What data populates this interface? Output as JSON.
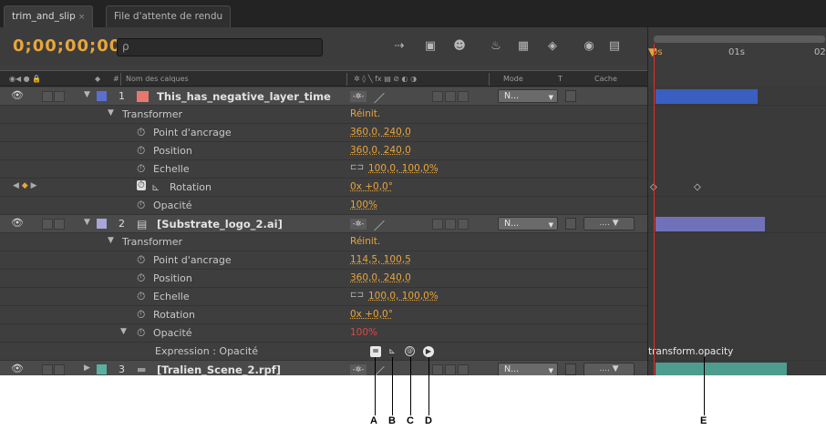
{
  "tabs": [
    {
      "label": "trim_and_slip",
      "close": "×"
    },
    {
      "label": "File d'attente de rendu"
    }
  ],
  "toolbar": {
    "timecode": "0;00;00;00",
    "search_icon": "ρ"
  },
  "columns": {
    "layer_name": "Nom des calques",
    "mode": "Mode",
    "t": "T",
    "cache": "Cache"
  },
  "timeline": {
    "ticks": [
      "0s",
      "01s",
      "02"
    ],
    "expression_text": "transform.opacity"
  },
  "layers": [
    {
      "index": "1",
      "name": "This_has_negative_layer_time",
      "color": "#e6786d",
      "mode": "N..."
    },
    {
      "index": "2",
      "name": "[Substrate_logo_2.ai]",
      "mode": "N..."
    },
    {
      "index": "3",
      "name": "[Tralien_Scene_2.rpf]",
      "mode": "N..."
    }
  ],
  "props1": {
    "transformer": "Transformer",
    "reinit": "Réinit.",
    "anchor": "Point d'ancrage",
    "anchor_val": "360,0, 240,0",
    "position": "Position",
    "position_val": "360,0, 240,0",
    "scale": "Echelle",
    "scale_val": "100,0, 100,0%",
    "rotation": "Rotation",
    "rotation_val": "0x +0,0°",
    "opacity": "Opacité",
    "opacity_val": "100%"
  },
  "props2": {
    "transformer": "Transformer",
    "reinit": "Réinit.",
    "anchor": "Point d'ancrage",
    "anchor_val": "114,5, 100,5",
    "position": "Position",
    "position_val": "360,0, 240,0",
    "scale": "Echelle",
    "scale_val": "100,0, 100,0%",
    "rotation": "Rotation",
    "rotation_val": "0x +0,0°",
    "opacity": "Opacité",
    "opacity_val": "100%",
    "expression": "Expression : Opacité"
  },
  "callouts": [
    "A",
    "B",
    "C",
    "D",
    "E"
  ],
  "colors": {
    "accent": "#e9a53a",
    "cti": "#e03030",
    "bar1": "#3a5fc0",
    "bar2": "#6f72b8",
    "bar3": "#4e9c8e"
  }
}
